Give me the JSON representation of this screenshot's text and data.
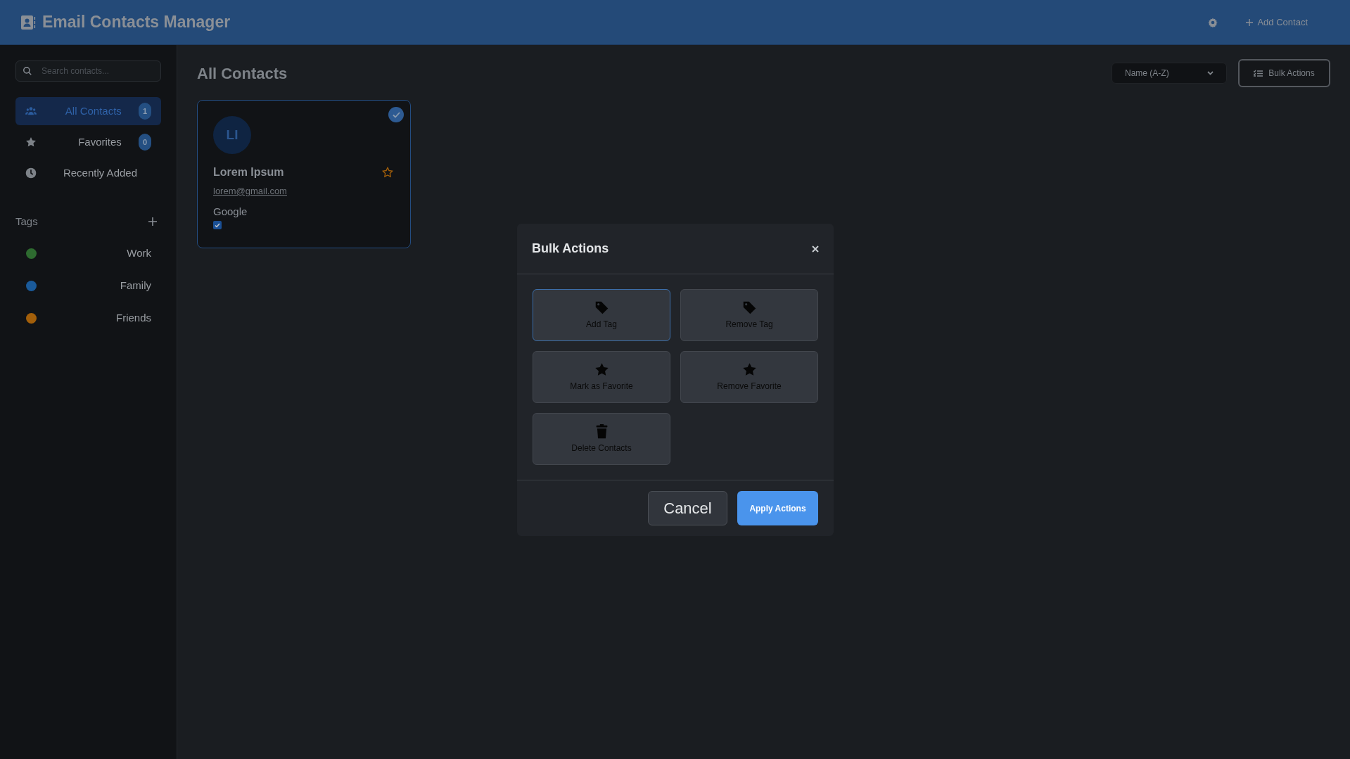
{
  "header": {
    "title": "Email Contacts Manager",
    "add_contact": "Add Contact"
  },
  "sidebar": {
    "search": {
      "placeholder": "Search contacts..."
    },
    "nav": [
      {
        "label": "All Contacts",
        "kind": "people",
        "count": "1",
        "selected": true
      },
      {
        "label": "Favorites",
        "kind": "star",
        "count": "0",
        "selected": false
      },
      {
        "label": "Recently Added",
        "kind": "clock",
        "selected": false
      }
    ],
    "tags_heading": "Tags",
    "tags": [
      {
        "label": "Work",
        "color": "#2e6b30"
      },
      {
        "label": "Family",
        "color": "#1a5a9a"
      },
      {
        "label": "Friends",
        "color": "#a35f0a"
      }
    ]
  },
  "main": {
    "title": "All Contacts",
    "sort": "Name (A-Z)",
    "bulk_button": "Bulk Actions"
  },
  "contacts": [
    {
      "initials": "LI",
      "name": "Lorem Ipsum",
      "email": "lorem@gmail.com",
      "company": "Google",
      "favorite": false,
      "selected": true,
      "checked": true
    }
  ],
  "modal": {
    "title": "Bulk Actions",
    "actions": [
      {
        "label": "Add Tag",
        "kind": "tag",
        "selected": true
      },
      {
        "label": "Remove Tag",
        "kind": "tag",
        "selected": false
      },
      {
        "label": "Mark as Favorite",
        "kind": "star",
        "selected": false
      },
      {
        "label": "Remove Favorite",
        "kind": "star",
        "selected": false
      },
      {
        "label": "Delete Contacts",
        "kind": "trash",
        "selected": false
      }
    ],
    "cancel": "Cancel",
    "apply": "Apply Actions"
  }
}
